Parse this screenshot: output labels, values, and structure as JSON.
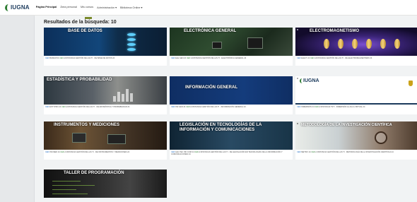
{
  "header": {
    "logo_text": "IUGNA",
    "nav": [
      "Página Principal",
      "Área personal",
      "Mis cursos",
      "Administración ▾",
      "Biblioteca Online ▾"
    ]
  },
  "results_title": "Resultados de la búsqueda: 10",
  "courses": [
    {
      "image_title": "BASE DE DATOS",
      "prefix": "CED",
      "code": "BASDAT24",
      "tag": "CED",
      "desc": "A DISTANCIA GESTIÓN DE LAS TI · DE BASE DE DATOS 24"
    },
    {
      "image_title": "ELECTRÓNICA GENERAL",
      "prefix": "CED",
      "code": "ELE GEN 24",
      "tag": "CED",
      "desc": "A DISTANCIA GESTIÓN DE LAS TI · ELECTRÓNICA GENERAL 24"
    },
    {
      "image_title": "ELECTROMAGNETISMO",
      "prefix": "CED",
      "code": "ELECT 24",
      "tag": "CED",
      "desc": "A DISTANCIA GESTIÓN DE LAS TI · DE ELECTROMAGNETISMO 24"
    },
    {
      "image_title": "ESTADÍSTICA Y PROBABILIDAD",
      "prefix": "CED",
      "code": "ESTYPRO 24",
      "tag": "CED",
      "desc": "A DISTANCIA GESTIÓN DE LAS TI · DE ESTADÍSTICA Y PROBABILIDAD 24"
    },
    {
      "image_title": "INFORMACIÓN GENERAL",
      "prefix": "CED",
      "code": "INF GEN 24",
      "tag": "CED",
      "desc": "A DISTANCIA GESTIÓN DE LAS TI · INFORMACIÓN GENERAL 24"
    },
    {
      "image_title": "",
      "logo_text": "IUGNA",
      "prefix": "CED",
      "code": "INMERSIÓN 24",
      "tag": "CED",
      "desc": "A DISTANCIA TSTI · INMERSIÓN AL AULA VIRTUAL 24"
    },
    {
      "image_title": "INSTRUMENTOS Y MEDICIONES",
      "prefix": "CED",
      "code": "INS MED 24",
      "tag": "CED",
      "desc": "A DISTANCIA GESTIÓN DE LAS TI · DE INSTRUMENTOS Y MEDICIONES 24"
    },
    {
      "image_title": "LEGISLACIÓN EN TECNOLOGÍAS DE LA\nINFORMACIÓN Y COMUNICACIONES",
      "prefix": "CED",
      "code": "LEG TEC INF COM 24",
      "tag": "CED",
      "desc": "A DISTANCIA GESTIÓN DE LAS TI · DE LEGISLACIÓN EN TECNOLOGÍAS DE LA INFORMACIÓN Y COMUNICACIONES 24"
    },
    {
      "image_title": "METODOLOGÍA DE LA INVESTIGACIÓN CIENTÍFICA",
      "prefix": "CED",
      "code": "METINV 24",
      "tag": "CED",
      "desc": "A DISTANCIA GESTIÓN DE LAS TI · METODOLOGÍA DE LA INVESTIGACIÓN CIENTÍFICA 24"
    },
    {
      "image_title": "TALLER DE PROGRAMACIÓN",
      "prefix": "",
      "code": "",
      "tag": "",
      "desc": ""
    }
  ]
}
